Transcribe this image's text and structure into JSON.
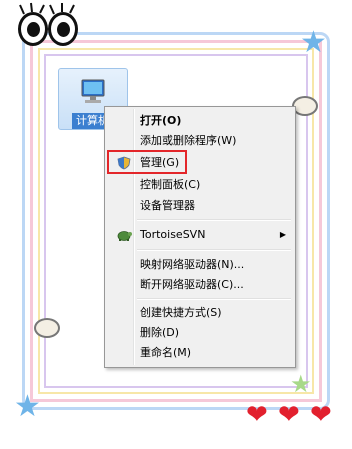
{
  "desktop": {
    "icon_label": "计算机"
  },
  "menu": {
    "items": [
      {
        "label": "打开(O)",
        "bold": true
      },
      {
        "label": "添加或删除程序(W)"
      },
      {
        "label": "管理(G)",
        "highlighted": true
      },
      {
        "label": "控制面板(C)"
      },
      {
        "label": "设备管理器"
      },
      {
        "label": "TortoiseSVN",
        "submenu": true
      },
      {
        "label": "映射网络驱动器(N)..."
      },
      {
        "label": "断开网络驱动器(C)..."
      },
      {
        "label": "创建快捷方式(S)"
      },
      {
        "label": "删除(D)"
      },
      {
        "label": "重命名(M)"
      }
    ]
  },
  "colors": {
    "highlight_border": "#e3262a",
    "heart": "#e2202e",
    "frame_blue": "#bcd7f5",
    "frame_pink": "#f6c8d8"
  }
}
